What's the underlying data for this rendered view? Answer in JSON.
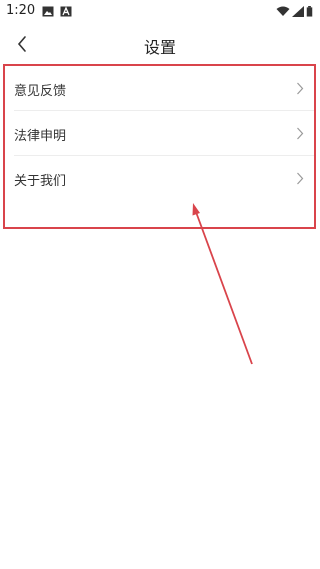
{
  "status_bar": {
    "time": "1:20"
  },
  "header": {
    "title": "设置",
    "back_icon": "back-chevron-icon"
  },
  "menu": {
    "items": [
      {
        "label": "意见反馈"
      },
      {
        "label": "法律申明"
      },
      {
        "label": "关于我们"
      }
    ]
  },
  "colors": {
    "highlight": "#d9444b",
    "divider": "#ededed",
    "chevron": "#9a9a9a"
  }
}
